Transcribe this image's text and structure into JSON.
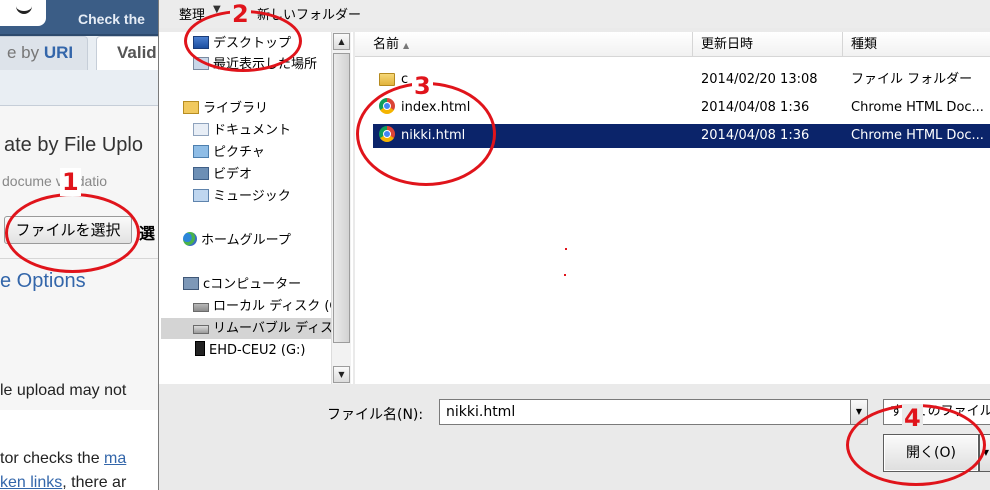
{
  "background_page": {
    "header_link": "Check the",
    "tab_uri_prefix": "e by ",
    "tab_uri_bold": "URI",
    "tab_active": "Valid",
    "section_title": "ate by File Uplo",
    "section_sub": " docume   validatio",
    "choose_file_button": "ファイルを選択",
    "choose_file_trunc": "選",
    "more_options": "e Options",
    "note": "le upload may not",
    "body_line1_prefix": "tor checks the ",
    "body_line1_link": "ma",
    "body_line2_link": "ken links",
    "body_line2_suffix": ", there ar"
  },
  "dialog": {
    "toolbar": {
      "organize": "整理",
      "new_folder": "新しいフォルダー"
    },
    "nav_items": [
      {
        "label": "デスクトップ",
        "icon": "desktop-icon"
      },
      {
        "label": "最近表示した場所",
        "icon": "recent-places-icon"
      },
      {
        "label": "ライブラリ",
        "icon": "libraries-icon"
      },
      {
        "label": "ドキュメント",
        "icon": "documents-icon"
      },
      {
        "label": "ピクチャ",
        "icon": "pictures-icon"
      },
      {
        "label": "ビデオ",
        "icon": "videos-icon"
      },
      {
        "label": "ミュージック",
        "icon": "music-icon"
      },
      {
        "label": "ホームグループ",
        "icon": "homegroup-icon"
      },
      {
        "label": "cコンピューター",
        "icon": "computer-icon"
      },
      {
        "label": "ローカル ディスク (C",
        "icon": "local-disk-icon"
      },
      {
        "label": "リムーバブル ディスク",
        "icon": "removable-disk-icon"
      },
      {
        "label": "EHD-CEU2 (G:)",
        "icon": "external-drive-icon"
      }
    ],
    "columns": {
      "name": "名前",
      "modified": "更新日時",
      "type": "種類"
    },
    "files": [
      {
        "name": "c",
        "modified": "2014/02/20 13:08",
        "type": "ファイル フォルダー",
        "icon": "folder-icon"
      },
      {
        "name": "index.html",
        "modified": "2014/04/08 1:36",
        "type": "Chrome HTML Doc...",
        "icon": "chrome-icon"
      },
      {
        "name": "nikki.html",
        "modified": "2014/04/08 1:36",
        "type": "Chrome HTML Doc...",
        "icon": "chrome-icon"
      }
    ],
    "filename_label": "ファイル名(N):",
    "filename_value": "nikki.html",
    "filter_value": "すべてのファイル",
    "open_button": "開く(O)"
  },
  "annotations": {
    "step1": "1",
    "step2": "2",
    "step3": "3",
    "step4": "4",
    "color": "#e0141b"
  },
  "colors": {
    "selection": "#0b246a",
    "header_bar": "#3b5d86",
    "link": "#3366aa"
  }
}
